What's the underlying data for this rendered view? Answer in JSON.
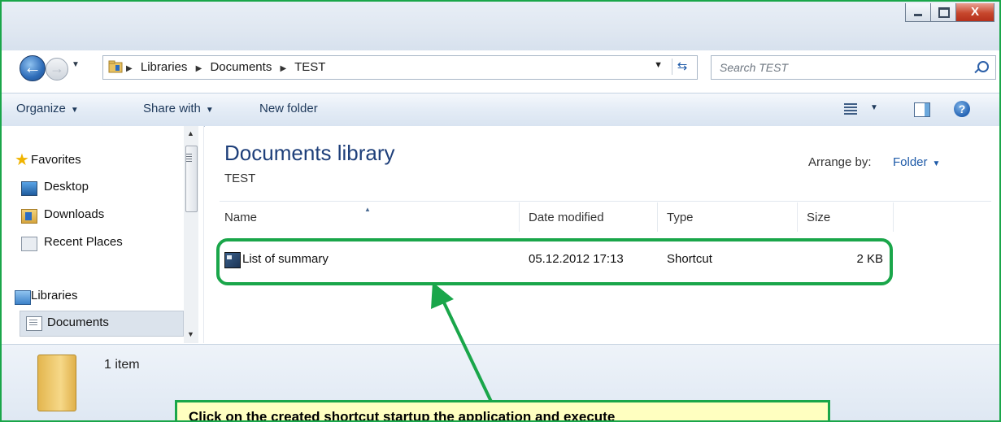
{
  "window": {
    "close_glyph": "X"
  },
  "address": {
    "crumbs": [
      "Libraries",
      "Documents",
      "TEST"
    ]
  },
  "search": {
    "placeholder": "Search TEST"
  },
  "toolbar": {
    "organize_label": "Organize",
    "share_label": "Share with",
    "new_folder_label": "New folder",
    "help_glyph": "?"
  },
  "sidebar": {
    "favorites_label": "Favorites",
    "items": [
      {
        "label": "Desktop",
        "icon": "desktop-icon"
      },
      {
        "label": "Downloads",
        "icon": "downloads-icon"
      },
      {
        "label": "Recent Places",
        "icon": "recent-places-icon"
      }
    ],
    "libraries_label": "Libraries",
    "documents_label": "Documents"
  },
  "content": {
    "title": "Documents library",
    "subtitle": "TEST",
    "arrange_label": "Arrange by:",
    "arrange_value": "Folder",
    "columns": [
      "Name",
      "Date modified",
      "Type",
      "Size"
    ],
    "rows": [
      {
        "name": "List of summary",
        "date": "05.12.2012 17:13",
        "type": "Shortcut",
        "size": "2 KB"
      }
    ]
  },
  "details": {
    "count": "1 item"
  },
  "callout": {
    "text": "Click on the created shortcut startup the application and execute"
  },
  "colors": {
    "highlight": "#1aa64a",
    "callout_bg": "#ffffc0"
  }
}
